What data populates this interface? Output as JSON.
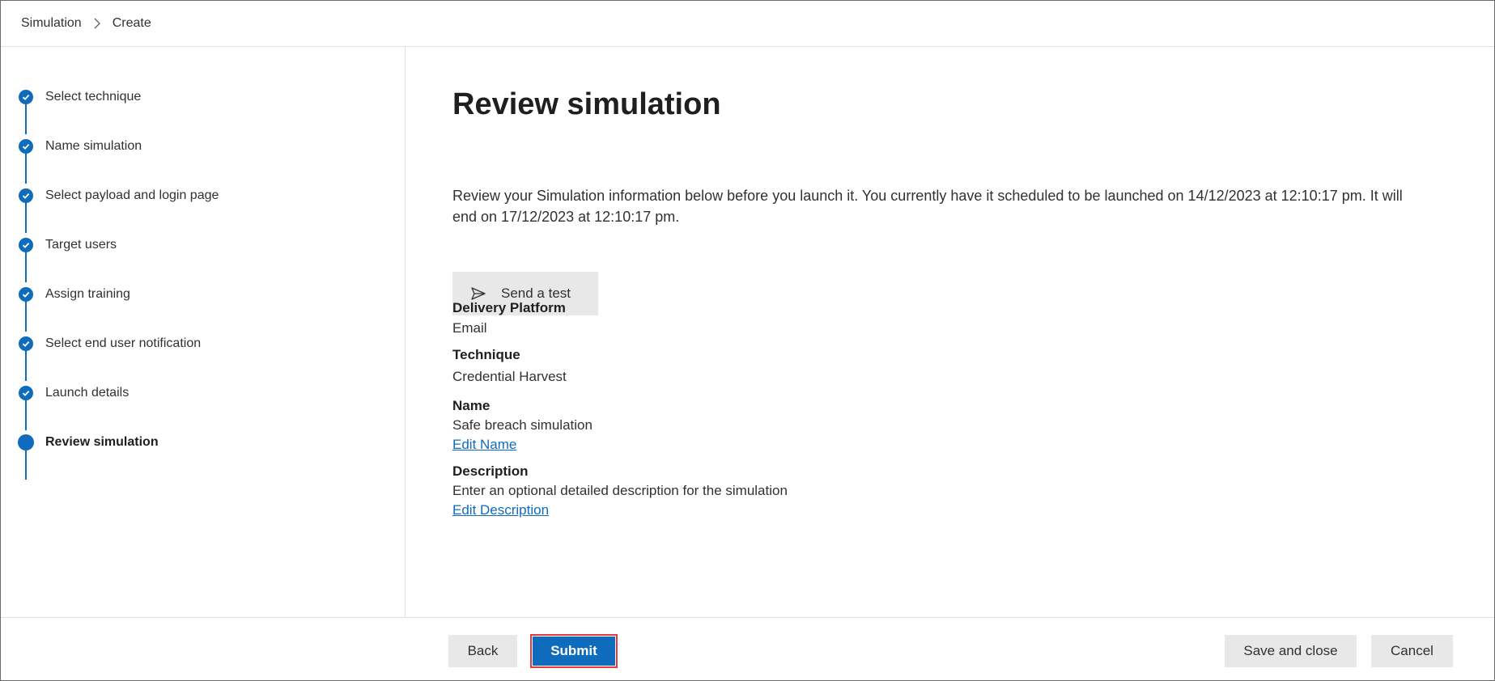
{
  "breadcrumb": {
    "items": [
      "Simulation",
      "Create"
    ]
  },
  "stepper": {
    "steps": [
      {
        "label": "Select technique",
        "status": "complete"
      },
      {
        "label": "Name simulation",
        "status": "complete"
      },
      {
        "label": "Select payload and login page",
        "status": "complete"
      },
      {
        "label": "Target users",
        "status": "complete"
      },
      {
        "label": "Assign training",
        "status": "complete"
      },
      {
        "label": "Select end user notification",
        "status": "complete"
      },
      {
        "label": "Launch details",
        "status": "complete"
      },
      {
        "label": "Review simulation",
        "status": "current"
      }
    ]
  },
  "main": {
    "title": "Review simulation",
    "intro": "Review your Simulation information below before you launch it. You currently have it scheduled to be launched on 14/12/2023 at 12:10:17 pm. It will end on 17/12/2023 at 12:10:17 pm.",
    "send_test_label": "Send a test",
    "send_test_icon": "send-icon",
    "fields": [
      {
        "label": "Delivery Platform",
        "value": "Email"
      },
      {
        "label": "Technique",
        "value": "Credential Harvest"
      },
      {
        "label": "Name",
        "value": "Safe breach simulation",
        "link": "Edit Name"
      },
      {
        "label": "Description",
        "value": "Enter an optional detailed description for the simulation",
        "link": "Edit Description"
      }
    ]
  },
  "footer": {
    "back_label": "Back",
    "submit_label": "Submit",
    "save_close_label": "Save and close",
    "cancel_label": "Cancel"
  },
  "colors": {
    "accent": "#0f6cbd",
    "highlight_border": "#e0383e",
    "button_bg": "#e8e8e8"
  }
}
